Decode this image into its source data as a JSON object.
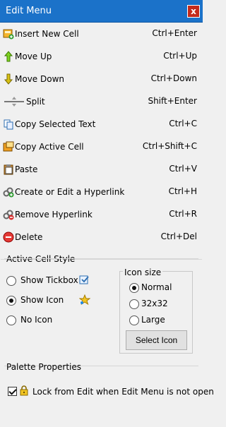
{
  "window": {
    "title": "Edit Menu",
    "close_label": "x"
  },
  "menu": [
    {
      "icon": "insert-cell-icon",
      "label": "Insert New Cell",
      "shortcut": "Ctrl+Enter"
    },
    {
      "icon": "arrow-up-icon",
      "label": "Move Up",
      "shortcut": "Ctrl+Up"
    },
    {
      "icon": "arrow-down-icon",
      "label": "Move Down",
      "shortcut": "Ctrl+Down"
    },
    {
      "icon": "split-icon",
      "label": "Split",
      "shortcut": "Shift+Enter"
    },
    {
      "icon": "copy-text-icon",
      "label": "Copy Selected Text",
      "shortcut": "Ctrl+C"
    },
    {
      "icon": "copy-cell-icon",
      "label": "Copy Active Cell",
      "shortcut": "Ctrl+Shift+C"
    },
    {
      "icon": "paste-icon",
      "label": "Paste",
      "shortcut": "Ctrl+V"
    },
    {
      "icon": "hyperlink-icon",
      "label": "Create or Edit a Hyperlink",
      "shortcut": "Ctrl+H"
    },
    {
      "icon": "remove-hyperlink-icon",
      "label": "Remove Hyperlink",
      "shortcut": "Ctrl+R"
    },
    {
      "icon": "delete-icon",
      "label": "Delete",
      "shortcut": "Ctrl+Del"
    }
  ],
  "active_cell_style": {
    "title": "Active Cell Style",
    "options": [
      {
        "label": "Show Tickbox",
        "checked": false
      },
      {
        "label": "Show Icon",
        "checked": true
      },
      {
        "label": "No Icon",
        "checked": false
      }
    ]
  },
  "icon_size": {
    "title": "Icon size",
    "options": [
      {
        "label": "Normal",
        "checked": true
      },
      {
        "label": "32x32",
        "checked": false
      },
      {
        "label": "Large",
        "checked": false
      }
    ],
    "select_button": "Select Icon"
  },
  "palette": {
    "title": "Palette Properties",
    "lock_label": "Lock from Edit when Edit Menu is not open",
    "lock_checked": true
  },
  "colors": {
    "titlebar": "#1b72c9",
    "close": "#c42b1c",
    "panel": "#f0f0f0"
  }
}
